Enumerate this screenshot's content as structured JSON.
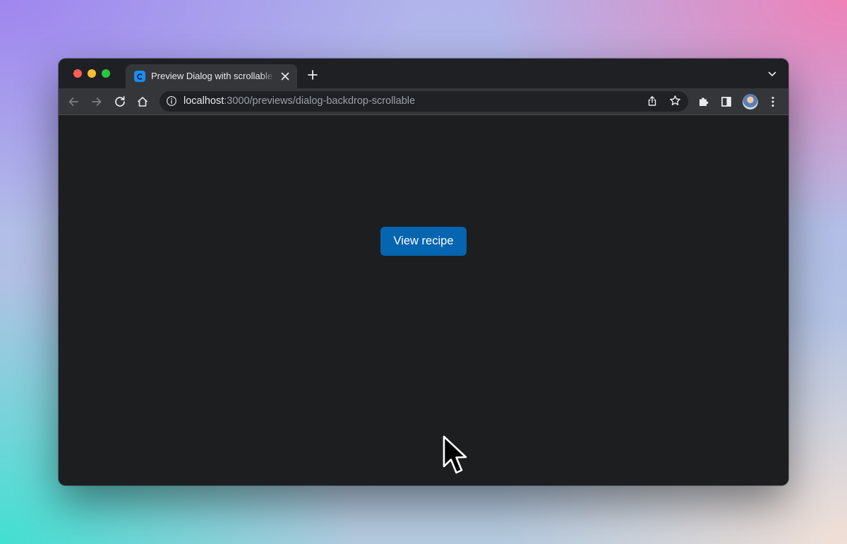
{
  "browser": {
    "tab": {
      "title": "Preview Dialog with scrollable backdrop"
    },
    "address": {
      "host": "localhost",
      "path": ":3000/previews/dialog-backdrop-scrollable"
    },
    "icons": {
      "back": "arrow-left-icon",
      "forward": "arrow-right-icon",
      "reload": "reload-icon",
      "home": "home-icon",
      "site_info": "info-icon",
      "share": "share-icon",
      "bookmark": "star-icon",
      "extensions": "puzzle-icon",
      "side_panel": "side-panel-icon",
      "menu": "more-vertical-icon"
    }
  },
  "page": {
    "button_label": "View recipe"
  },
  "colors": {
    "page_background": "#1d1e20",
    "button": "#0565b0",
    "favicon": "#1a8df0"
  }
}
